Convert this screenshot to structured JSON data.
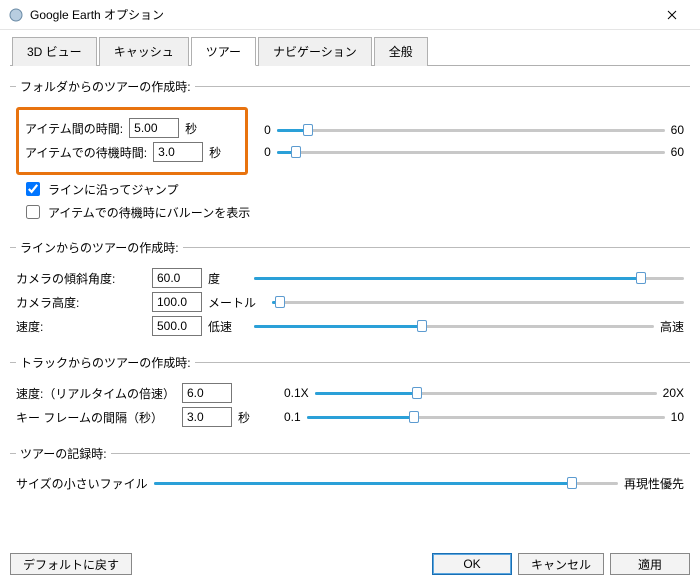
{
  "window": {
    "title": "Google Earth オプション"
  },
  "tabs": {
    "view3d": "3D ビュー",
    "cache": "キャッシュ",
    "tour": "ツアー",
    "nav": "ナビゲーション",
    "general": "全般"
  },
  "section1": {
    "legend": "フォルダからのツアーの作成時:",
    "time_between_label": "アイテム間の時間:",
    "time_between_value": "5.00",
    "time_between_unit": "秒",
    "wait_label": "アイテムでの待機時間:",
    "wait_value": "3.0",
    "wait_unit": "秒",
    "slider1_min": "0",
    "slider1_max": "60",
    "slider2_min": "0",
    "slider2_max": "60",
    "chk1_label": "ラインに沿ってジャンプ",
    "chk2_label": "アイテムでの待機時にバルーンを表示"
  },
  "section2": {
    "legend": "ラインからのツアーの作成時:",
    "tilt_label": "カメラの傾斜角度:",
    "tilt_value": "60.0",
    "tilt_unit": "度",
    "alt_label": "カメラ高度:",
    "alt_value": "100.0",
    "alt_unit": "メートル",
    "speed_label": "速度:",
    "speed_value": "500.0",
    "speed_min": "低速",
    "speed_max": "高速"
  },
  "section3": {
    "legend": "トラックからのツアーの作成時:",
    "speed_label": "速度:（リアルタイムの倍速）",
    "speed_value": "6.0",
    "speed_min": "0.1X",
    "speed_max": "20X",
    "kf_label": "キー フレームの間隔（秒）",
    "kf_value": "3.0",
    "kf_unit": "秒",
    "kf_min": "0.1",
    "kf_max": "10"
  },
  "section4": {
    "legend": "ツアーの記録時:",
    "size_min": "サイズの小さいファイル",
    "size_max": "再現性優先"
  },
  "buttons": {
    "reset": "デフォルトに戻す",
    "ok": "OK",
    "cancel": "キャンセル",
    "apply": "適用"
  }
}
